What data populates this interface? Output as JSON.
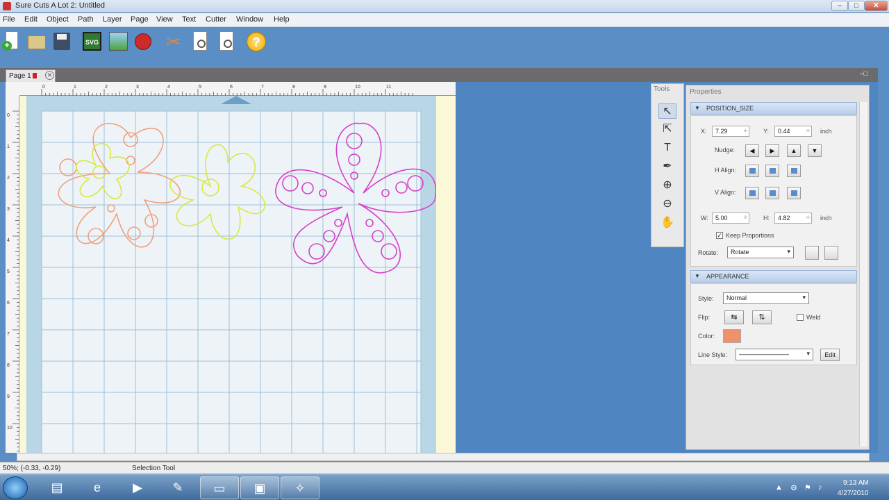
{
  "window": {
    "title": "Sure Cuts A Lot 2: Untitled",
    "min_glyph": "–",
    "max_glyph": "□",
    "close_glyph": "✕"
  },
  "menu": [
    "File",
    "Edit",
    "Object",
    "Path",
    "Layer",
    "Page",
    "View",
    "Text",
    "Cutter",
    "Window",
    "Help"
  ],
  "toolbar": {
    "svg_badge": "SVG",
    "help_glyph": "?",
    "buttons": [
      "new-document",
      "open",
      "save",
      "import-svg",
      "import-image",
      "import-special",
      "cut",
      "page-setup",
      "preview",
      "help"
    ]
  },
  "document": {
    "tab_label": "Page 1",
    "tab_close": "✕",
    "restore_glyph": "–□"
  },
  "ruler_top_labels": [
    "0",
    "1",
    "2",
    "3",
    "4",
    "5",
    "6",
    "7",
    "8",
    "9",
    "10",
    "11"
  ],
  "ruler_left_labels": [
    "0",
    "1",
    "2",
    "3",
    "4",
    "5",
    "6",
    "7",
    "8",
    "9",
    "10"
  ],
  "tools": {
    "title": "Tools",
    "items": [
      {
        "name": "selection-tool",
        "glyph": "↖"
      },
      {
        "name": "node-edit-tool",
        "glyph": "⇱"
      },
      {
        "name": "text-tool",
        "glyph": "T"
      },
      {
        "name": "pen-tool",
        "glyph": "✒"
      },
      {
        "name": "zoom-in-tool",
        "glyph": "⊕"
      },
      {
        "name": "zoom-out-tool",
        "glyph": "⊖"
      },
      {
        "name": "pan-tool",
        "glyph": "✋"
      }
    ]
  },
  "properties": {
    "title": "Properties",
    "position_size": {
      "header": "POSITION_SIZE",
      "x_label": "X:",
      "x_value": "7.29",
      "y_label": "Y:",
      "y_value": "0.44",
      "unit1": "inch",
      "nudge_label": "Nudge:",
      "nudge_glyphs": [
        "◀",
        "▶",
        "▲",
        "▼"
      ],
      "halign_label": "H Align:",
      "valign_label": "V Align:",
      "w_label": "W:",
      "w_value": "5.00",
      "h_label": "H:",
      "h_value": "4.82",
      "unit2": "inch",
      "check_glyph": "✓",
      "keep_proportions_label": "Keep Proportions",
      "rotate_label": "Rotate:",
      "rotate_value": "Rotate"
    },
    "appearance": {
      "header": "APPEARANCE",
      "style_label": "Style:",
      "style_value": "Normal",
      "flip_label": "Flip:",
      "flip_h_glyph": "⇆",
      "flip_v_glyph": "⇅",
      "weld_label": "Weld",
      "color_label": "Color:",
      "color_value": "#f0916a",
      "line_style_label": "Line Style:",
      "line_style_value": "————————",
      "edit_label": "Edit"
    }
  },
  "status": {
    "zoom_coords": "50%; (-0.33, -0.29)",
    "tool": "Selection Tool"
  },
  "taskbar": {
    "items": [
      {
        "name": "explorer",
        "glyph": "▤",
        "running": false
      },
      {
        "name": "internet-explorer",
        "glyph": "e",
        "running": false
      },
      {
        "name": "media-player",
        "glyph": "▶",
        "running": false
      },
      {
        "name": "paint-app",
        "glyph": "✎",
        "running": false
      },
      {
        "name": "folder-window",
        "glyph": "▭",
        "running": true
      },
      {
        "name": "sure-cuts-a-lot",
        "glyph": "▣",
        "running": true
      },
      {
        "name": "compass-app",
        "glyph": "✧",
        "running": true
      }
    ],
    "time": "9:13 AM",
    "date": "4/27/2010"
  },
  "colors": {
    "flower_orange": "#f0a07a",
    "flower_yellow": "#d8e840",
    "flower_magenta": "#d640c8",
    "mat_grid": "#8fb8d4"
  }
}
